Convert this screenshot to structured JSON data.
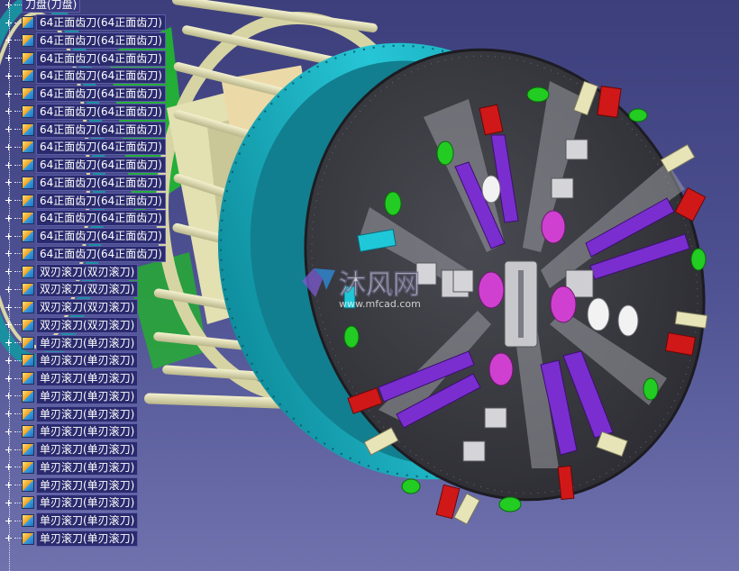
{
  "spec_tree": {
    "root_label": "刀盘(刀盘)",
    "items": [
      {
        "label": "64正面齿刀(64正面齿刀)"
      },
      {
        "label": "64正面齿刀(64正面齿刀)"
      },
      {
        "label": "64正面齿刀(64正面齿刀)"
      },
      {
        "label": "64正面齿刀(64正面齿刀)"
      },
      {
        "label": "64正面齿刀(64正面齿刀)"
      },
      {
        "label": "64正面齿刀(64正面齿刀)"
      },
      {
        "label": "64正面齿刀(64正面齿刀)"
      },
      {
        "label": "64正面齿刀(64正面齿刀)"
      },
      {
        "label": "64正面齿刀(64正面齿刀)"
      },
      {
        "label": "64正面齿刀(64正面齿刀)"
      },
      {
        "label": "64正面齿刀(64正面齿刀)"
      },
      {
        "label": "64正面齿刀(64正面齿刀)"
      },
      {
        "label": "64正面齿刀(64正面齿刀)"
      },
      {
        "label": "64正面齿刀(64正面齿刀)"
      },
      {
        "label": "双刃滚刀(双刃滚刀)"
      },
      {
        "label": "双刃滚刀(双刃滚刀)"
      },
      {
        "label": "双刃滚刀(双刃滚刀)"
      },
      {
        "label": "双刃滚刀(双刃滚刀)"
      },
      {
        "label": "单刃滚刀(单刃滚刀)"
      },
      {
        "label": "单刃滚刀(单刃滚刀)"
      },
      {
        "label": "单刃滚刀(单刃滚刀)"
      },
      {
        "label": "单刃滚刀(单刃滚刀)"
      },
      {
        "label": "单刃滚刀(单刃滚刀)"
      },
      {
        "label": "单刃滚刀(单刃滚刀)"
      },
      {
        "label": "单刃滚刀(单刃滚刀)"
      },
      {
        "label": "单刃滚刀(单刃滚刀)"
      },
      {
        "label": "单刃滚刀(单刃滚刀)"
      },
      {
        "label": "单刃滚刀(单刃滚刀)"
      },
      {
        "label": "单刃滚刀(单刃滚刀)"
      },
      {
        "label": "单刃滚刀(单刃滚刀)"
      }
    ]
  },
  "watermark": {
    "brand": "沐风网",
    "url": "www.mfcad.com"
  },
  "colors": {
    "background_top": "#3d3f7c",
    "background_bottom": "#6f72ad",
    "cutterhead_face": "#3b3b42",
    "ring": "#1fb8c8",
    "frame": "#e6e3b4",
    "tooth_purple": "#7a2ed0",
    "scraper_red": "#d01818",
    "roller_green": "#22cc22",
    "disc_magenta": "#d040d0"
  }
}
